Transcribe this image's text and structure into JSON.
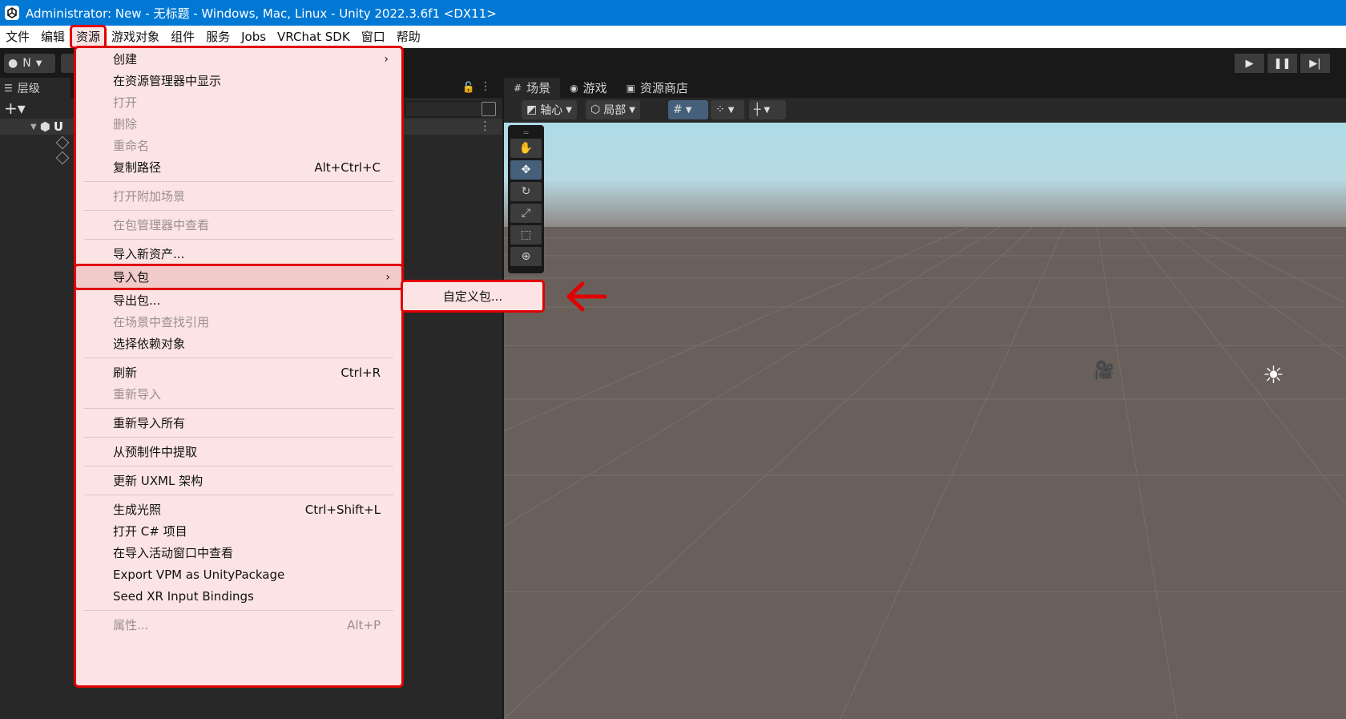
{
  "titlebar": {
    "title": "Administrator: New - 无标题 - Windows, Mac, Linux - Unity 2022.3.6f1 <DX11>"
  },
  "menubar": {
    "items": [
      "文件",
      "编辑",
      "资源",
      "游戏对象",
      "组件",
      "服务",
      "Jobs",
      "VRChat SDK",
      "窗口",
      "帮助"
    ]
  },
  "toolbar": {
    "account_label": "N"
  },
  "hierarchy": {
    "tab": "层级",
    "scene_root": "U"
  },
  "scene_view": {
    "tabs": [
      "场景",
      "游戏",
      "资源商店"
    ],
    "pivot_label": "轴心",
    "local_label": "局部"
  },
  "assets_menu": {
    "create": "创建",
    "show_in_explorer": "在资源管理器中显示",
    "open": "打开",
    "delete": "删除",
    "rename": "重命名",
    "copy_path": "复制路径",
    "copy_path_sc": "Alt+Ctrl+C",
    "open_additive": "打开附加场景",
    "view_in_pm": "在包管理器中查看",
    "import_new": "导入新资产...",
    "import_package": "导入包",
    "export_package": "导出包...",
    "find_refs": "在场景中查找引用",
    "select_deps": "选择依赖对象",
    "refresh": "刷新",
    "refresh_sc": "Ctrl+R",
    "reimport": "重新导入",
    "reimport_all": "重新导入所有",
    "extract_prefab": "从预制件中提取",
    "update_uxml": "更新 UXML 架构",
    "gen_lighting": "生成光照",
    "gen_lighting_sc": "Ctrl+Shift+L",
    "open_cs": "打开 C# 项目",
    "view_import_window": "在导入活动窗口中查看",
    "export_vpm": "Export VPM as UnityPackage",
    "seed_xr": "Seed XR Input Bindings",
    "properties": "属性...",
    "properties_sc": "Alt+P"
  },
  "submenu": {
    "custom_package": "自定义包..."
  },
  "colors": {
    "highlight": "#e00000",
    "menu_bg": "#fde4e4",
    "titlebar": "#0078d4"
  }
}
